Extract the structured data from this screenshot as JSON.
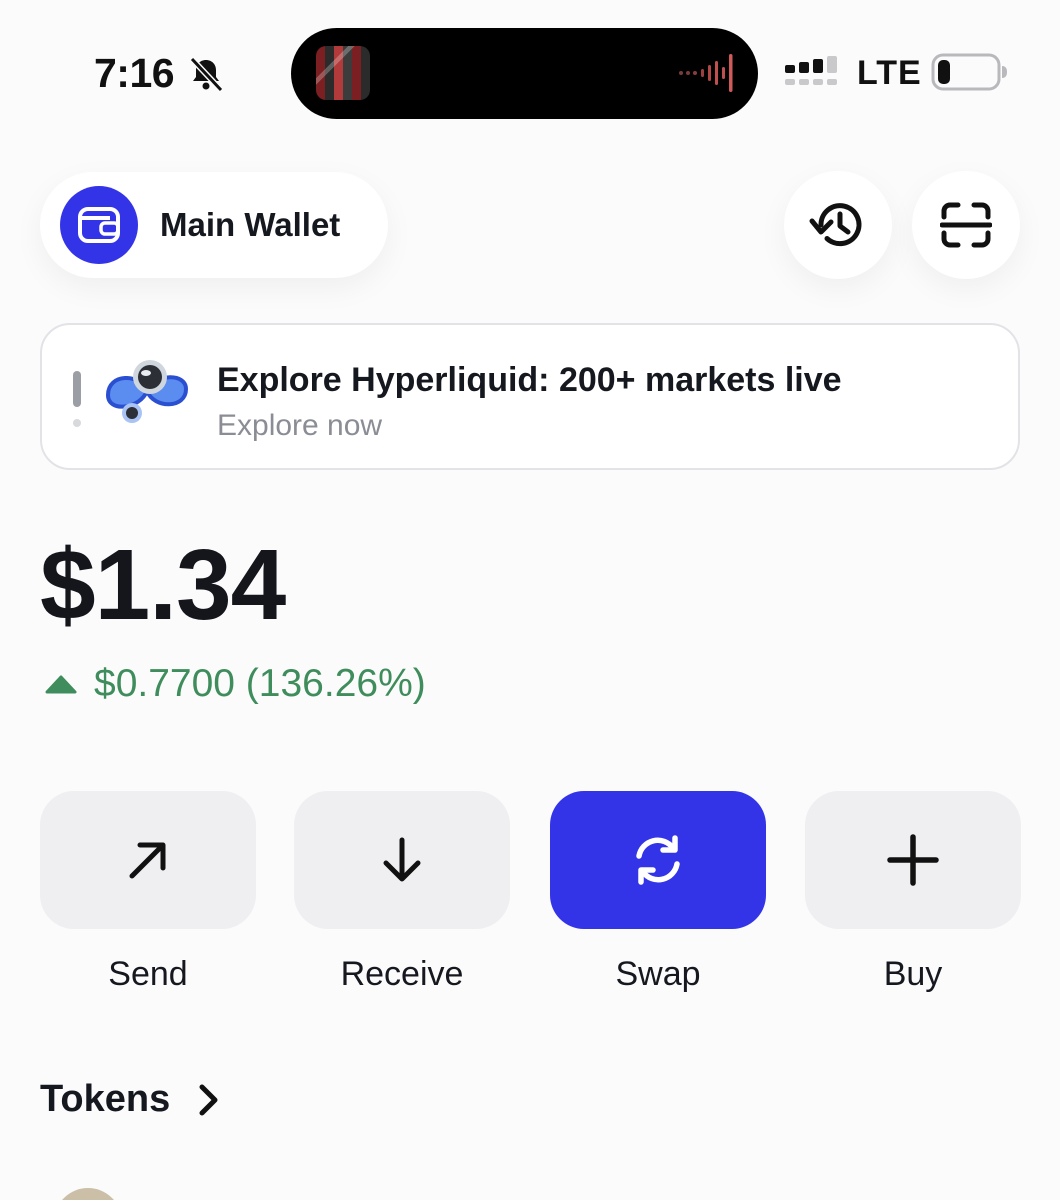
{
  "status_bar": {
    "time": "7:16",
    "network": "LTE",
    "icons": [
      "bell-slash-icon",
      "signal-icon",
      "battery-icon",
      "waveform-icon"
    ]
  },
  "header": {
    "wallet_name": "Main Wallet",
    "wallet_icon": "wallet-icon",
    "history_icon": "history-icon",
    "scan_icon": "scan-icon"
  },
  "banner": {
    "title": "Explore Hyperliquid: 200+ markets live",
    "subtitle": "Explore now",
    "logo": "hyperliquid-logo"
  },
  "portfolio": {
    "balance": "$1.34",
    "change": "$0.7700 (136.26%)",
    "change_direction": "up"
  },
  "actions": [
    {
      "label": "Send",
      "icon": "arrow-up-right-icon"
    },
    {
      "label": "Receive",
      "icon": "arrow-down-icon"
    },
    {
      "label": "Swap",
      "icon": "swap-icon"
    },
    {
      "label": "Buy",
      "icon": "plus-icon"
    }
  ],
  "tokens": {
    "title": "Tokens"
  },
  "colors": {
    "accent": "#3333e8",
    "positive": "#3f8d5c",
    "background": "#fbfbfc",
    "button_bg": "#efeff2"
  }
}
